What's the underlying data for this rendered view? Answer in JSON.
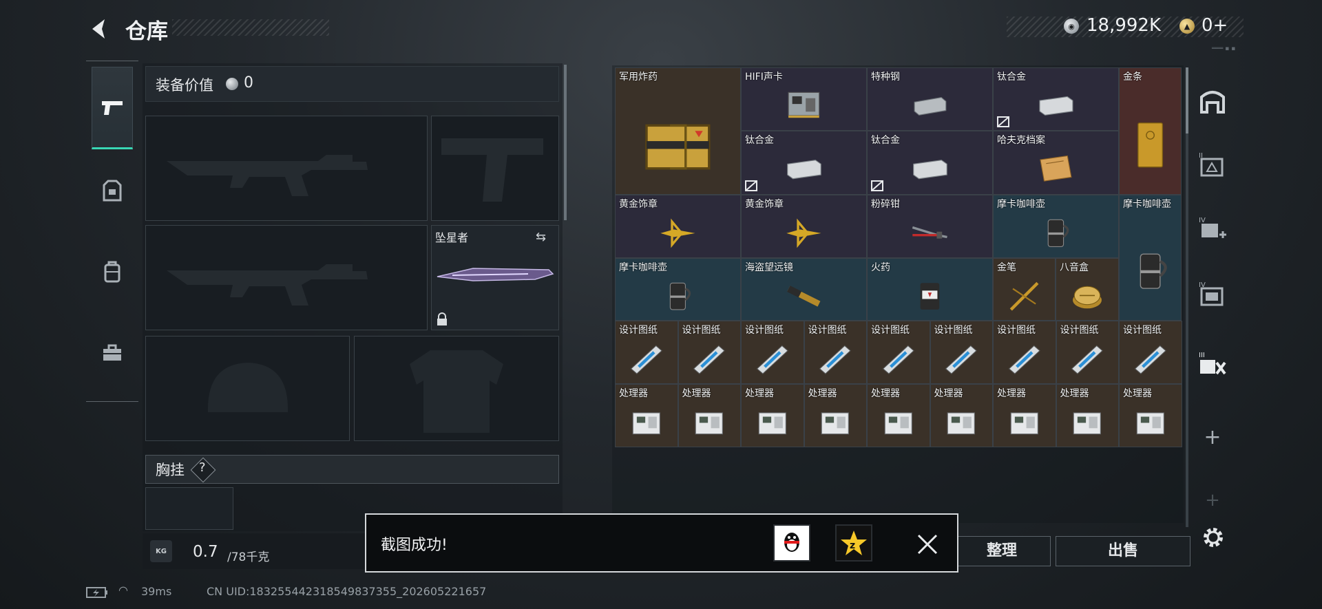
{
  "header": {
    "title": "仓库",
    "currency_silver": "18,992K",
    "currency_gold": "0+",
    "corner_tiny": "═══ ▪ ▪"
  },
  "equipment": {
    "value_label": "装备价值",
    "value": "0",
    "melee_name": "坠星者",
    "vest_label": "胸挂",
    "vest_help": "?",
    "weight_icon": "KG",
    "weight_current": "0.7",
    "weight_max": "/78千克"
  },
  "stash": {
    "items": [
      {
        "label": "军用炸药",
        "rarity": "brown",
        "icon": "explosive-crate-icon"
      },
      {
        "label": "HIFI声卡",
        "rarity": "purple",
        "icon": "sound-card-icon"
      },
      {
        "label": "特种钢",
        "rarity": "purple",
        "icon": "steel-ingot-icon"
      },
      {
        "label": "钛合金",
        "rarity": "purple",
        "icon": "titanium-ingot-icon",
        "no_repair": true
      },
      {
        "label": "金条",
        "rarity": "red",
        "icon": "gold-bar-icon"
      },
      {
        "label": "钛合金",
        "rarity": "purple",
        "icon": "titanium-ingot-icon",
        "no_repair": true
      },
      {
        "label": "钛合金",
        "rarity": "purple",
        "icon": "titanium-ingot-icon",
        "no_repair": true
      },
      {
        "label": "哈夫克档案",
        "rarity": "purple",
        "icon": "archive-file-icon"
      },
      {
        "label": "黄金饰章",
        "rarity": "purple",
        "icon": "gold-emblem-icon"
      },
      {
        "label": "黄金饰章",
        "rarity": "purple",
        "icon": "gold-emblem-icon"
      },
      {
        "label": "粉碎钳",
        "rarity": "purple",
        "icon": "crusher-pliers-icon"
      },
      {
        "label": "摩卡咖啡壶",
        "rarity": "teal",
        "icon": "moka-pot-icon"
      },
      {
        "label": "摩卡咖啡壶",
        "rarity": "teal",
        "icon": "moka-pot-icon"
      },
      {
        "label": "摩卡咖啡壶",
        "rarity": "teal",
        "icon": "moka-pot-icon"
      },
      {
        "label": "海盗望远镜",
        "rarity": "teal",
        "icon": "spyglass-icon"
      },
      {
        "label": "火药",
        "rarity": "teal",
        "icon": "gunpowder-icon"
      },
      {
        "label": "金笔",
        "rarity": "brown",
        "icon": "gold-pen-icon"
      },
      {
        "label": "八音盒",
        "rarity": "brown",
        "icon": "music-box-icon"
      },
      {
        "label": "设计图纸",
        "rarity": "brown",
        "icon": "blueprint-icon"
      },
      {
        "label": "设计图纸",
        "rarity": "brown",
        "icon": "blueprint-icon"
      },
      {
        "label": "设计图纸",
        "rarity": "brown",
        "icon": "blueprint-icon"
      },
      {
        "label": "设计图纸",
        "rarity": "brown",
        "icon": "blueprint-icon"
      },
      {
        "label": "设计图纸",
        "rarity": "brown",
        "icon": "blueprint-icon"
      },
      {
        "label": "设计图纸",
        "rarity": "brown",
        "icon": "blueprint-icon"
      },
      {
        "label": "设计图纸",
        "rarity": "brown",
        "icon": "blueprint-icon"
      },
      {
        "label": "设计图纸",
        "rarity": "brown",
        "icon": "blueprint-icon"
      },
      {
        "label": "设计图纸",
        "rarity": "brown",
        "icon": "blueprint-icon"
      },
      {
        "label": "处理器",
        "rarity": "brown",
        "icon": "processor-icon"
      },
      {
        "label": "处理器",
        "rarity": "brown",
        "icon": "processor-icon"
      },
      {
        "label": "处理器",
        "rarity": "brown",
        "icon": "processor-icon"
      },
      {
        "label": "处理器",
        "rarity": "brown",
        "icon": "processor-icon"
      },
      {
        "label": "处理器",
        "rarity": "brown",
        "icon": "processor-icon"
      },
      {
        "label": "处理器",
        "rarity": "brown",
        "icon": "processor-icon"
      },
      {
        "label": "处理器",
        "rarity": "brown",
        "icon": "processor-icon"
      },
      {
        "label": "处理器",
        "rarity": "brown",
        "icon": "processor-icon"
      },
      {
        "label": "处理器",
        "rarity": "brown",
        "icon": "processor-icon"
      }
    ]
  },
  "right_tabs": [
    "vault-icon",
    "tier-ii-case-icon",
    "tier-iv-case-plus-icon",
    "tier-iv-case-icon",
    "tier-iii-tools-icon",
    "add-icon",
    "add-icon-faded"
  ],
  "buttons": {
    "sort": "整理",
    "sell": "出售"
  },
  "toast": {
    "message": "截图成功!",
    "qq_icon": "qq-penguin-icon",
    "qzone_icon": "qzone-star-icon"
  },
  "status": {
    "ping": "39ms",
    "uid": "CN UID:18325544231854983735​5_202605221657"
  },
  "colors": {
    "accent": "#38d7b4",
    "brown": "#3a3128",
    "purple": "#2c2a3a",
    "teal": "#233a46",
    "red": "#4a2c2a"
  }
}
